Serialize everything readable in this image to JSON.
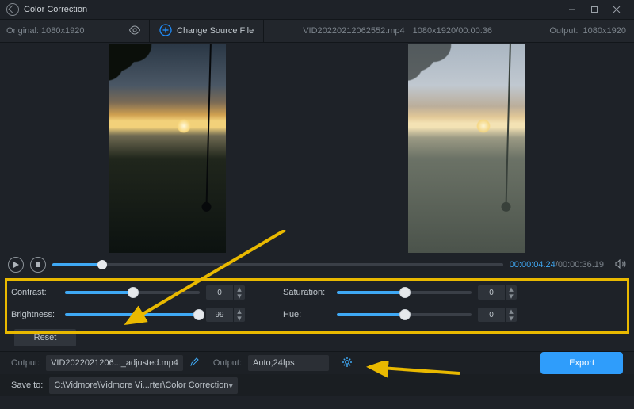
{
  "title": "Color Correction",
  "toolbar": {
    "original_label": "Original:",
    "original_dims": "1080x1920",
    "change_source_label": "Change Source File",
    "filename": "VID20220212062552.mp4",
    "file_dims": "1080x1920",
    "file_duration": "00:00:36",
    "output_label": "Output:",
    "output_dims": "1080x1920"
  },
  "playback": {
    "current_time": "00:00:04.24",
    "total_time": "00:00:36.19",
    "progress_pct": 11
  },
  "controls": {
    "contrast": {
      "label": "Contrast:",
      "value": 0,
      "pct": 50
    },
    "brightness": {
      "label": "Brightness:",
      "value": 99,
      "pct": 99
    },
    "saturation": {
      "label": "Saturation:",
      "value": 0,
      "pct": 50
    },
    "hue": {
      "label": "Hue:",
      "value": 0,
      "pct": 50
    },
    "reset_label": "Reset"
  },
  "output_bar": {
    "output_file_label": "Output:",
    "output_file": "VID2022021206..._adjusted.mp4",
    "output_fmt_label": "Output:",
    "output_fmt": "Auto;24fps",
    "export_label": "Export"
  },
  "save_bar": {
    "save_to_label": "Save to:",
    "save_to_path": "C:\\Vidmore\\Vidmore Vi...rter\\Color Correction"
  }
}
